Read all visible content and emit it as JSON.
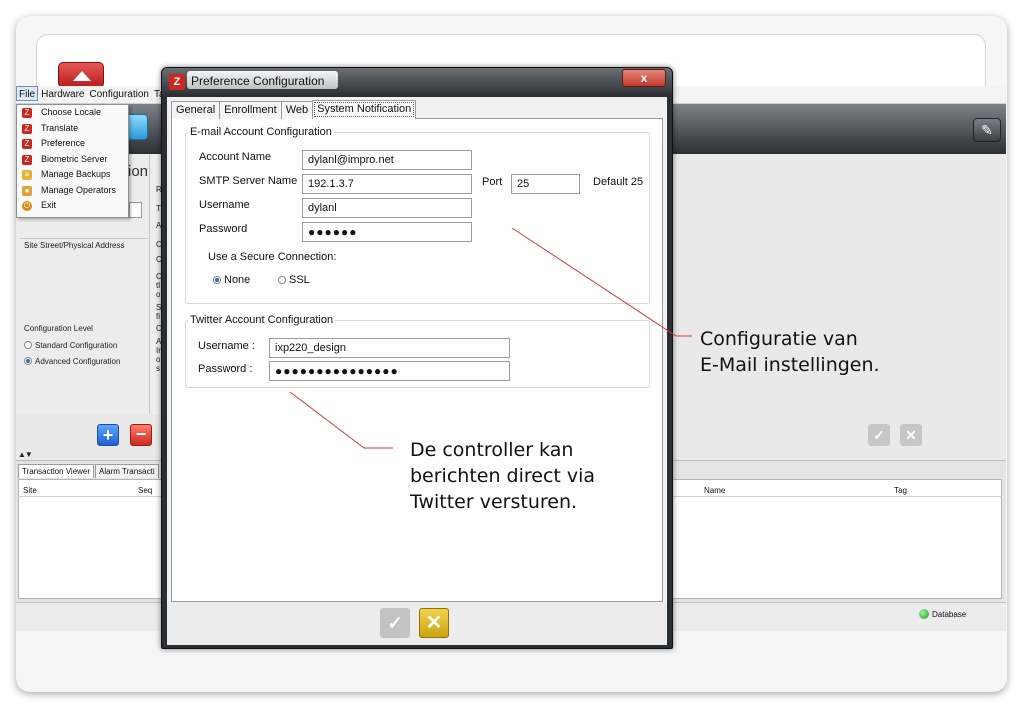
{
  "menubar": {
    "items": [
      "File",
      "Hardware",
      "Configuration",
      "Ta"
    ]
  },
  "file_menu": {
    "items": [
      {
        "label": "Choose Locale",
        "icon": "app-logo-icon",
        "color": "#c8281f"
      },
      {
        "label": "Translate",
        "icon": "app-logo-icon",
        "color": "#c8281f"
      },
      {
        "label": "Preference",
        "icon": "app-logo-icon",
        "color": "#c8281f"
      },
      {
        "label": "Biometric Server",
        "icon": "app-logo-icon",
        "color": "#c8281f"
      },
      {
        "label": "Manage Backups",
        "icon": "backup-icon",
        "color": "#e2b23a"
      },
      {
        "label": "Manage Operators",
        "icon": "operators-icon",
        "color": "#e2a23a"
      },
      {
        "label": "Exit",
        "icon": "exit-icon",
        "color": "#d98a10"
      }
    ]
  },
  "background": {
    "partial_title": "ion",
    "site_street_label": "Site Street/Physical Address",
    "config_level_label": "Configuration Level",
    "standard_config": "Standard Configuration",
    "advanced_config": "Advanced Configuration",
    "col_letters": [
      "R",
      "T",
      "A",
      "C",
      "C",
      "C",
      "tl",
      "o",
      "S",
      "fi",
      "C",
      "A",
      "Ir",
      "o",
      "s"
    ]
  },
  "bottom": {
    "tabs": [
      "Transaction Viewer",
      "Alarm Transacti"
    ],
    "columns": {
      "site": "Site",
      "seq": "Seq",
      "name": "Name",
      "tag": "Tag"
    },
    "status": "Database"
  },
  "dialog": {
    "title": "Preference Configuration",
    "close_label": "x",
    "tabs": [
      "General",
      "Enrollment",
      "Web",
      "System Notification"
    ],
    "selected_tab": "System Notification",
    "email": {
      "legend": "E-mail Account Configuration",
      "account_name_label": "Account Name",
      "account_name": "dylanl@impro.net",
      "smtp_label": "SMTP Server Name",
      "smtp": "192.1.3.7",
      "port_label": "Port",
      "port": "25",
      "port_default": "Default 25",
      "username_label": "Username",
      "username": "dylanl",
      "password_label": "Password",
      "password": "●●●●●●",
      "secure_label": "Use a Secure Connection:",
      "secure_options": [
        "None",
        "SSL"
      ],
      "secure_selected": "None"
    },
    "twitter": {
      "legend": "Twitter Account Configuration",
      "username_label": "Username :",
      "username": "ixp220_design",
      "password_label": "Password :",
      "password": "●●●●●●●●●●●●●●●"
    }
  },
  "callouts": {
    "email_line1": "Configuratie van",
    "email_line2": "E-Mail instellingen.",
    "twitter_line1": "De controller kan",
    "twitter_line2": "berichten direct via",
    "twitter_line3": "Twitter versturen."
  },
  "colors": {
    "accent_red": "#c8281f",
    "cancel_yellow": "#d8b21f",
    "callout_line": "#d33a3a"
  }
}
